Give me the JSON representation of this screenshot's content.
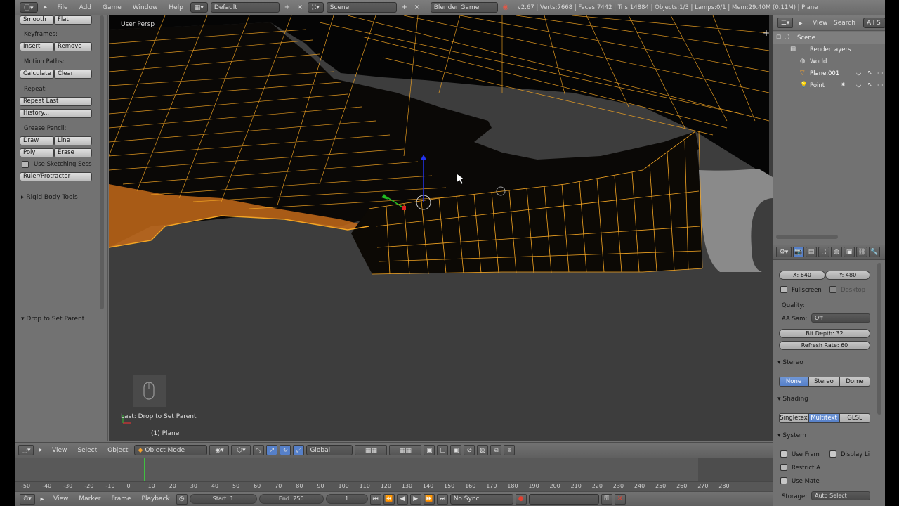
{
  "topbar": {
    "menu": [
      "File",
      "Add",
      "Game",
      "Window",
      "Help"
    ],
    "layout": "Default",
    "scene": "Scene",
    "engine": "Blender Game",
    "stats": "v2.67 | Verts:7668 | Faces:7442 | Tris:14884 | Objects:1/3 | Lamps:0/1 | Mem:29.40M (0.11M) | Plane"
  },
  "toolshelf": {
    "smooth": "Smooth",
    "flat": "Flat",
    "keyframes_label": "Keyframes:",
    "insert": "Insert",
    "remove": "Remove",
    "motion_label": "Motion Paths:",
    "calculate": "Calculate",
    "clear": "Clear",
    "repeat_label": "Repeat:",
    "repeat_last": "Repeat Last",
    "history": "History...",
    "grease_label": "Grease Pencil:",
    "draw": "Draw",
    "line": "Line",
    "poly": "Poly",
    "erase": "Erase",
    "sketching": "Use Sketching Sess",
    "ruler": "Ruler/Protractor",
    "rigid_body": "Rigid Body Tools",
    "drop_parent": "Drop to Set Parent"
  },
  "viewport": {
    "persp_label": "User Persp",
    "last_op": "Last: Drop to Set Parent",
    "object_label": "(1) Plane"
  },
  "vpheader": {
    "view": "View",
    "select": "Select",
    "object": "Object",
    "mode": "Object Mode",
    "orientation": "Global"
  },
  "timeline": {
    "ruler": [
      "-50",
      "-40",
      "-30",
      "-20",
      "-10",
      "0",
      "10",
      "20",
      "30",
      "40",
      "50",
      "60",
      "70",
      "80",
      "90",
      "100",
      "110",
      "120",
      "130",
      "140",
      "150",
      "160",
      "170",
      "180",
      "190",
      "200",
      "210",
      "220",
      "230",
      "240",
      "250",
      "260",
      "270",
      "280"
    ],
    "view": "View",
    "marker": "Marker",
    "frame": "Frame",
    "playback": "Playback",
    "start": "Start: 1",
    "end": "End: 250",
    "current": "1",
    "sync": "No Sync"
  },
  "outliner": {
    "view": "View",
    "search": "Search",
    "all": "All S",
    "items": [
      "Scene",
      "RenderLayers",
      "World",
      "Plane.001",
      "Point"
    ]
  },
  "props": {
    "x": "X: 640",
    "y": "Y: 480",
    "fullscreen": "Fullscreen",
    "desktop": "Desktop",
    "quality_label": "Quality:",
    "aa_label": "AA Sam:",
    "aa_value": "Off",
    "bit_depth": "Bit Depth: 32",
    "refresh": "Refresh Rate: 60",
    "stereo_head": "Stereo",
    "stereo_opts": [
      "None",
      "Stereo",
      "Dome"
    ],
    "shading_head": "Shading",
    "shading_opts": [
      "Singletex",
      "Multitext",
      "GLSL"
    ],
    "system_head": "System",
    "use_fram": "Use Fram",
    "display_li": "Display Li",
    "restrict_a": "Restrict A",
    "use_mate": "Use Mate",
    "storage_label": "Storage:",
    "storage_value": "Auto Select"
  },
  "colors": {
    "wire": "#f5a623",
    "selected_blue": "#5680c9"
  }
}
